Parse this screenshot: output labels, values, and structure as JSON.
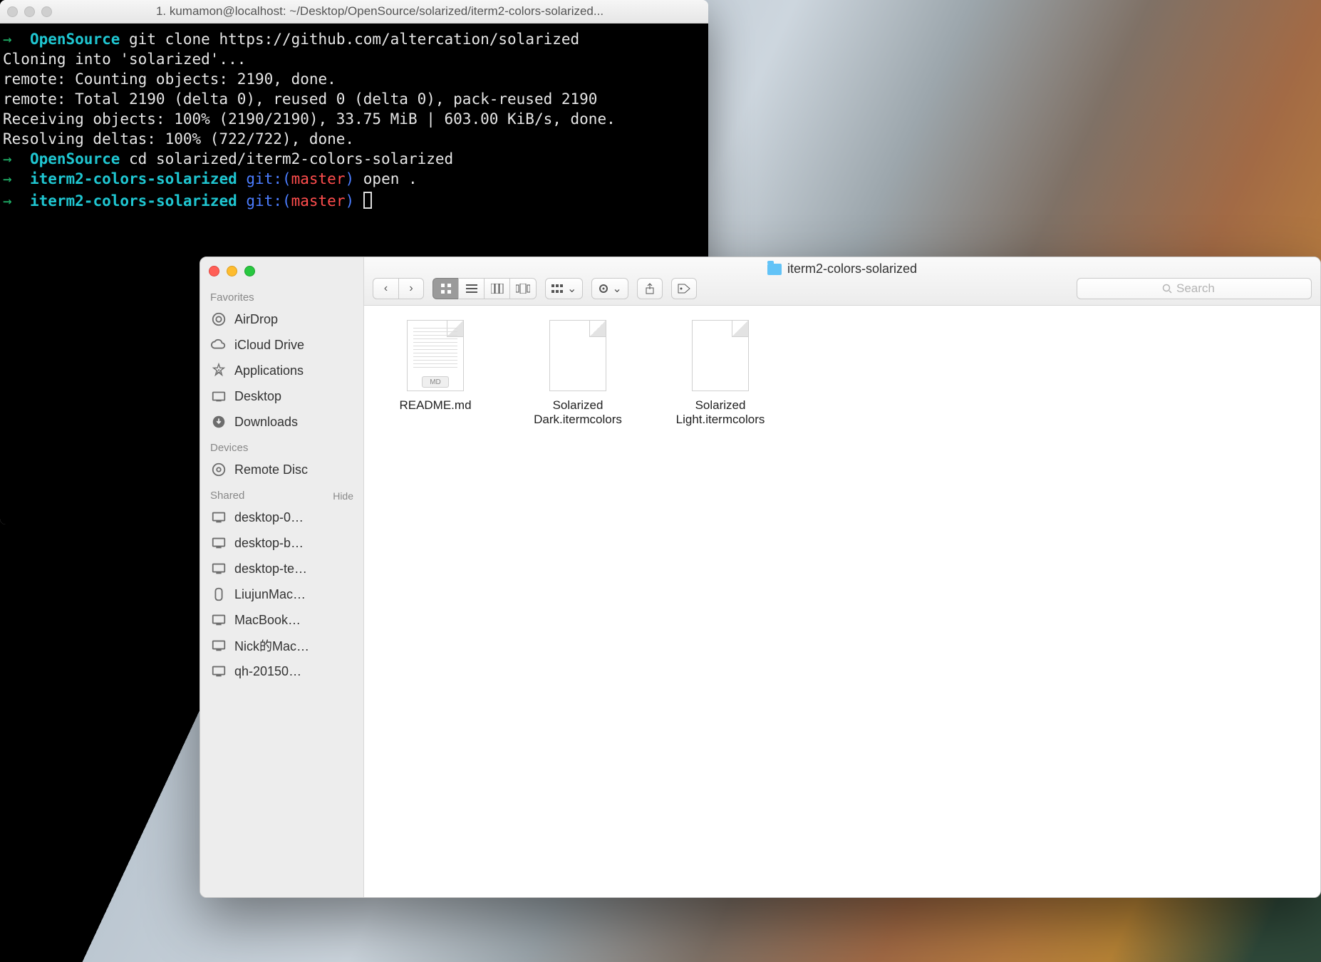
{
  "terminal": {
    "title": "1. kumamon@localhost: ~/Desktop/OpenSource/solarized/iterm2-colors-solarized...",
    "lines": {
      "p1_dir": "OpenSource",
      "p1_cmd": "git clone https://github.com/altercation/solarized",
      "l2": "Cloning into 'solarized'...",
      "l3": "remote: Counting objects: 2190, done.",
      "l4": "remote: Total 2190 (delta 0), reused 0 (delta 0), pack-reused 2190",
      "l5": "Receiving objects: 100% (2190/2190), 33.75 MiB | 603.00 KiB/s, done.",
      "l6": "Resolving deltas: 100% (722/722), done.",
      "p2_dir": "OpenSource",
      "p2_cmd": "cd solarized/iterm2-colors-solarized",
      "p3_dir": "iterm2-colors-solarized",
      "p3_git": "git:(",
      "p3_branch": "master",
      "p3_gitend": ")",
      "p3_cmd": "open .",
      "p4_dir": "iterm2-colors-solarized",
      "p4_git": "git:(",
      "p4_branch": "master",
      "p4_gitend": ")"
    }
  },
  "finder": {
    "title": "iterm2-colors-solarized",
    "search_placeholder": "Search",
    "sidebar": {
      "favorites_label": "Favorites",
      "favorites": [
        {
          "label": "AirDrop"
        },
        {
          "label": "iCloud Drive"
        },
        {
          "label": "Applications"
        },
        {
          "label": "Desktop"
        },
        {
          "label": "Downloads"
        }
      ],
      "devices_label": "Devices",
      "devices": [
        {
          "label": "Remote Disc"
        }
      ],
      "shared_label": "Shared",
      "shared_hide": "Hide",
      "shared": [
        {
          "label": "desktop-0…"
        },
        {
          "label": "desktop-b…"
        },
        {
          "label": "desktop-te…"
        },
        {
          "label": "LiujunMac…"
        },
        {
          "label": "MacBook…"
        },
        {
          "label": "Nick的Mac…"
        },
        {
          "label": "qh-20150…"
        }
      ]
    },
    "files": [
      {
        "name": "README.md",
        "md": true
      },
      {
        "name": "Solarized Dark.itermcolors",
        "md": false
      },
      {
        "name": "Solarized Light.itermcolors",
        "md": false
      }
    ]
  }
}
